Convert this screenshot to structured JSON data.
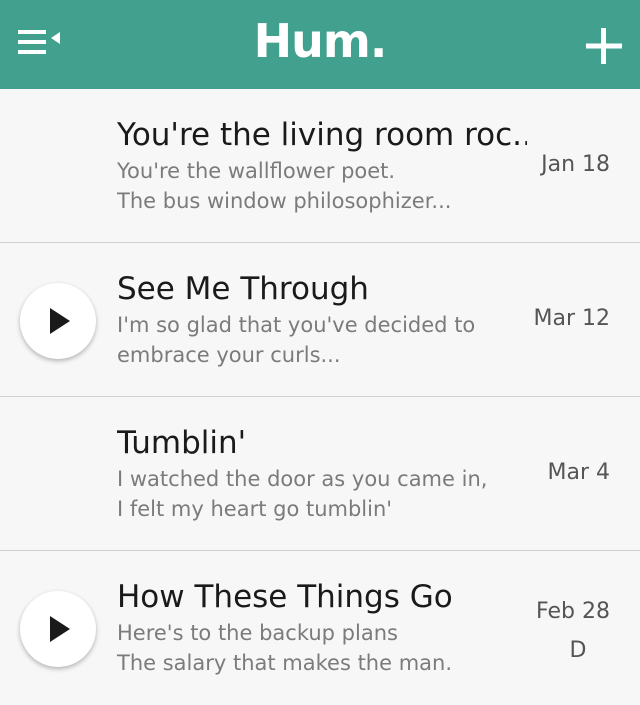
{
  "header": {
    "logo": "Hum.",
    "background": "#42a08f",
    "menu_icon": "menu-collapse-icon",
    "add_icon": "plus-icon"
  },
  "songs": [
    {
      "title": "You're the living room roc...",
      "line1": "You're the wallflower poet.",
      "line2": "The bus window philosophizer...",
      "date": "Jan 18",
      "has_audio": false
    },
    {
      "title": "See Me Through",
      "line1": "I'm so glad that you've decided to",
      "line2": "embrace your curls...",
      "date": "Mar 12",
      "has_audio": true
    },
    {
      "title": "Tumblin'",
      "line1": "I watched the door as you came in,",
      "line2": "I felt my heart go tumblin'",
      "date": "Mar 4",
      "has_audio": false
    },
    {
      "title": "How These Things Go",
      "line1": "Here's to the backup plans",
      "line2": "The salary that makes the man.",
      "date": "Feb 28",
      "date_sub": "D",
      "has_audio": true
    }
  ]
}
